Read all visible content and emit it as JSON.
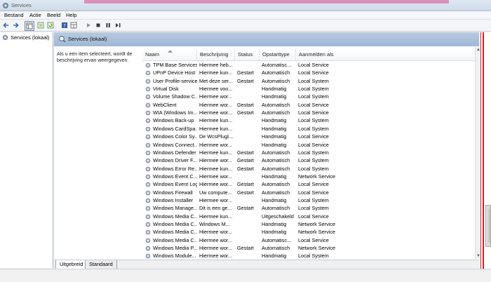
{
  "window": {
    "title": "Services"
  },
  "menu": [
    "Bestand",
    "Actie",
    "Beeld",
    "Help"
  ],
  "tree": {
    "item": "Services (lokaal)"
  },
  "panel": {
    "title": "Services (lokaal)",
    "description": "Als u een item selecteert, wordt de beschrijving ervan weergegeven."
  },
  "columns": [
    "Naam",
    "Beschrijving",
    "Status",
    "Opstarttype",
    "Aanmelden als"
  ],
  "rows": [
    [
      "TPM Base Services",
      "Hiermee heb...",
      "",
      "Automatisc...",
      "Local Service"
    ],
    [
      "UPnP Device Host",
      "Hiermee kun...",
      "Gestart",
      "Automatisch",
      "Local Service"
    ],
    [
      "User Profile-service",
      "Met deze ser...",
      "Gestart",
      "Automatisch",
      "Local System"
    ],
    [
      "Virtual Disk",
      "Hiermee voo...",
      "",
      "Handmatig",
      "Local System"
    ],
    [
      "Volume Shadow C...",
      "Hiermee wor...",
      "",
      "Handmatig",
      "Local System"
    ],
    [
      "WebClient",
      "Hiermee wor...",
      "Gestart",
      "Automatisch",
      "Local Service"
    ],
    [
      "WIA (Windows Im...",
      "Hiermee wor...",
      "Gestart",
      "Automatisch",
      "Local Service"
    ],
    [
      "Windows Back-up",
      "Hiermee kun...",
      "",
      "Handmatig",
      "Local System"
    ],
    [
      "Windows CardSpa...",
      "Hiermee kun...",
      "",
      "Handmatig",
      "Local System"
    ],
    [
      "Windows Color Sy...",
      "De WcsPlugI...",
      "",
      "Handmatig",
      "Local Service"
    ],
    [
      "Windows Connect...",
      "Hiermee wor...",
      "",
      "Handmatig",
      "Local Service"
    ],
    [
      "Windows Defender",
      "Hiermee kun...",
      "Gestart",
      "Automatisch",
      "Local System"
    ],
    [
      "Windows Driver F...",
      "Hiermee wor...",
      "Gestart",
      "Automatisch",
      "Local System"
    ],
    [
      "Windows Error Re...",
      "Hiermee kun...",
      "Gestart",
      "Automatisch",
      "Local System"
    ],
    [
      "Windows Event C...",
      "Hiermee wor...",
      "",
      "Handmatig",
      "Network Service"
    ],
    [
      "Windows Event Log",
      "Hiermee wor...",
      "Gestart",
      "Automatisch",
      "Local Service"
    ],
    [
      "Windows Firewall",
      "Uw compute...",
      "Gestart",
      "Automatisch",
      "Local Service"
    ],
    [
      "Windows Installer",
      "Hiermee wor...",
      "",
      "Handmatig",
      "Local System"
    ],
    [
      "Windows Manage...",
      "Dit is een ge...",
      "Gestart",
      "Automatisch",
      "Local System"
    ],
    [
      "Windows Media C...",
      "Hiermee kun...",
      "",
      "Uitgeschakeld",
      "Local Service"
    ],
    [
      "Windows Media C...",
      "Windows M...",
      "",
      "Handmatig",
      "Network Service"
    ],
    [
      "Windows Media C...",
      "Hiermee wor...",
      "",
      "Handmatig",
      "Network Service"
    ],
    [
      "Windows Media C...",
      "Hiermee wor...",
      "",
      "Automatisc...",
      "Local Service"
    ],
    [
      "Windows Media P...",
      "Hiermee wor...",
      "Gestart",
      "Automatisch",
      "Network Service"
    ],
    [
      "Windows Module...",
      "Hiermee wor...",
      "",
      "Handmatig",
      "Local System"
    ]
  ],
  "tabs": [
    "Uitgebreid",
    "Standaard"
  ],
  "icons": {
    "app": "services-gear-icon",
    "back": "back-arrow-icon",
    "forward": "forward-arrow-icon",
    "sort": "sort-ascending-icon",
    "service": "gear-icon"
  },
  "colors": {
    "panel_header": "#a9c0d9",
    "selection_red": "#cc1f1f"
  }
}
